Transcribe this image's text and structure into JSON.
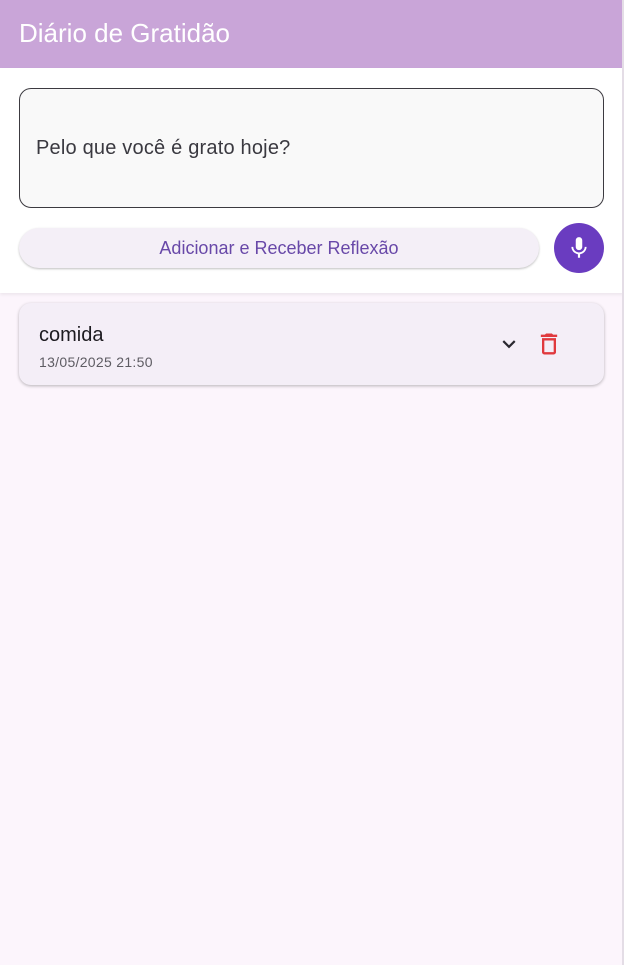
{
  "app_bar": {
    "title": "Diário de Gratidão"
  },
  "input_panel": {
    "placeholder": "Pelo que você é grato hoje?",
    "value": "",
    "add_button_label": "Adicionar e Receber Reflexão"
  },
  "entries": [
    {
      "title": "comida",
      "date": "13/05/2025 21:50"
    }
  ],
  "icons": {
    "mic": "mic-icon",
    "expand": "chevron-down-icon",
    "delete": "trash-icon"
  },
  "colors": {
    "app_bar": "#c9a5d8",
    "accent": "#6a3cc0",
    "button_text": "#6848a8",
    "delete": "#e0393e",
    "background": "#fcf5fc"
  }
}
